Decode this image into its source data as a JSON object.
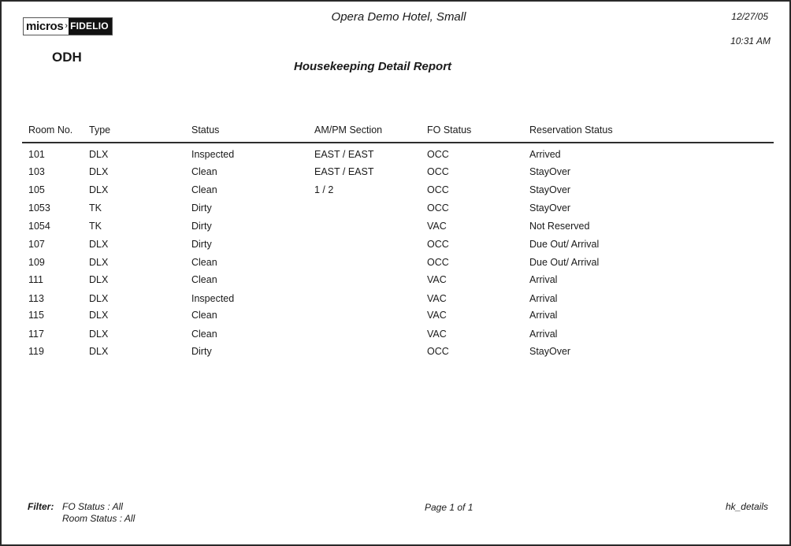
{
  "header": {
    "logo_left": "micros",
    "logo_arrow": "›",
    "logo_right": "FIDELIO",
    "property_code": "ODH",
    "hotel_name": "Opera Demo Hotel, Small",
    "report_title": "Housekeeping Detail Report",
    "date": "12/27/05",
    "time": "10:31 AM"
  },
  "table": {
    "columns": [
      "Room No.",
      "Type",
      "Status",
      "AM/PM Section",
      "FO Status",
      "Reservation Status"
    ],
    "rows": [
      [
        "101",
        "DLX",
        "Inspected",
        "EAST / EAST",
        "OCC",
        "Arrived"
      ],
      [
        "103",
        "DLX",
        "Clean",
        "EAST / EAST",
        "OCC",
        "StayOver"
      ],
      [
        "105",
        "DLX",
        "Clean",
        "1 / 2",
        "OCC",
        "StayOver"
      ],
      [
        "1053",
        "TK",
        "Dirty",
        "",
        "OCC",
        "StayOver"
      ],
      [
        "1054",
        "TK",
        "Dirty",
        "",
        "VAC",
        "Not Reserved"
      ],
      [
        "107",
        "DLX",
        "Dirty",
        "",
        "OCC",
        "Due Out/ Arrival"
      ],
      [
        "109",
        "DLX",
        "Clean",
        "",
        "OCC",
        "Due Out/ Arrival"
      ],
      [
        "111",
        "DLX",
        "Clean",
        "",
        "VAC",
        "Arrival"
      ],
      [
        "113",
        "DLX",
        "Inspected",
        "",
        "VAC",
        "Arrival"
      ],
      [
        "115",
        "DLX",
        "Clean",
        "",
        "VAC",
        "Arrival"
      ],
      [
        "117",
        "DLX",
        "Clean",
        "",
        "VAC",
        "Arrival"
      ],
      [
        "119",
        "DLX",
        "Dirty",
        "",
        "OCC",
        "StayOver"
      ]
    ]
  },
  "footer": {
    "filter_label": "Filter:",
    "filters": [
      "FO Status : All",
      "Room Status : All"
    ],
    "page_info": "Page 1  of 1",
    "report_id": "hk_details"
  }
}
